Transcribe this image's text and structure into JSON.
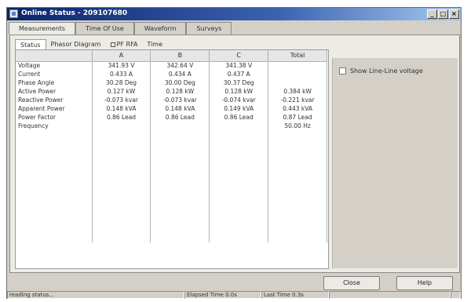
{
  "window": {
    "title": "Online Status - 209107680"
  },
  "tabs": [
    "Measurements",
    "Time Of Use",
    "Waveform",
    "Surveys"
  ],
  "subtabs": [
    "Status",
    "Phasor Diagram",
    "PF RFA",
    "Time"
  ],
  "table": {
    "headers": [
      "",
      "A",
      "B",
      "C",
      "Total"
    ],
    "rows": [
      [
        "Voltage",
        "341.93 V",
        "342.64 V",
        "341.38 V",
        ""
      ],
      [
        "Current",
        "0.433 A",
        "0.434 A",
        "0.437 A",
        ""
      ],
      [
        "Phase Angle",
        "30.28 Deg",
        "30.00 Deg",
        "30.37 Deg",
        ""
      ],
      [
        "Active Power",
        "0.127 kW",
        "0.128 kW",
        "0.128 kW",
        "0.384 kW"
      ],
      [
        "Reactive Power",
        "-0.073 kvar",
        "-0.073 kvar",
        "-0.074 kvar",
        "-0.221 kvar"
      ],
      [
        "Apparent Power",
        "0.148 kVA",
        "0.148 kVA",
        "0.149 kVA",
        "0.443 kVA"
      ],
      [
        "Power Factor",
        "0.86 Lead",
        "0.86 Lead",
        "0.86 Lead",
        "0.87 Lead"
      ],
      [
        "Frequency",
        "",
        "",
        "",
        "50.00 Hz"
      ]
    ]
  },
  "options": {
    "show_line_line_voltage": "Show Line-Line voltage",
    "show_line_line_checked": false
  },
  "buttons": {
    "close": "Close",
    "help": "Help"
  },
  "statusbar": {
    "status": "reading status...",
    "elapsed": "Elapsed Time 0.0s",
    "last": "Last Time 0.3s"
  },
  "window_buttons": {
    "minimize": "_",
    "maximize": "□",
    "close": "×"
  },
  "colors": {
    "titlebar_start": "#0a246a",
    "titlebar_end": "#a6caf0",
    "dialog_face": "#d4d0c8"
  }
}
